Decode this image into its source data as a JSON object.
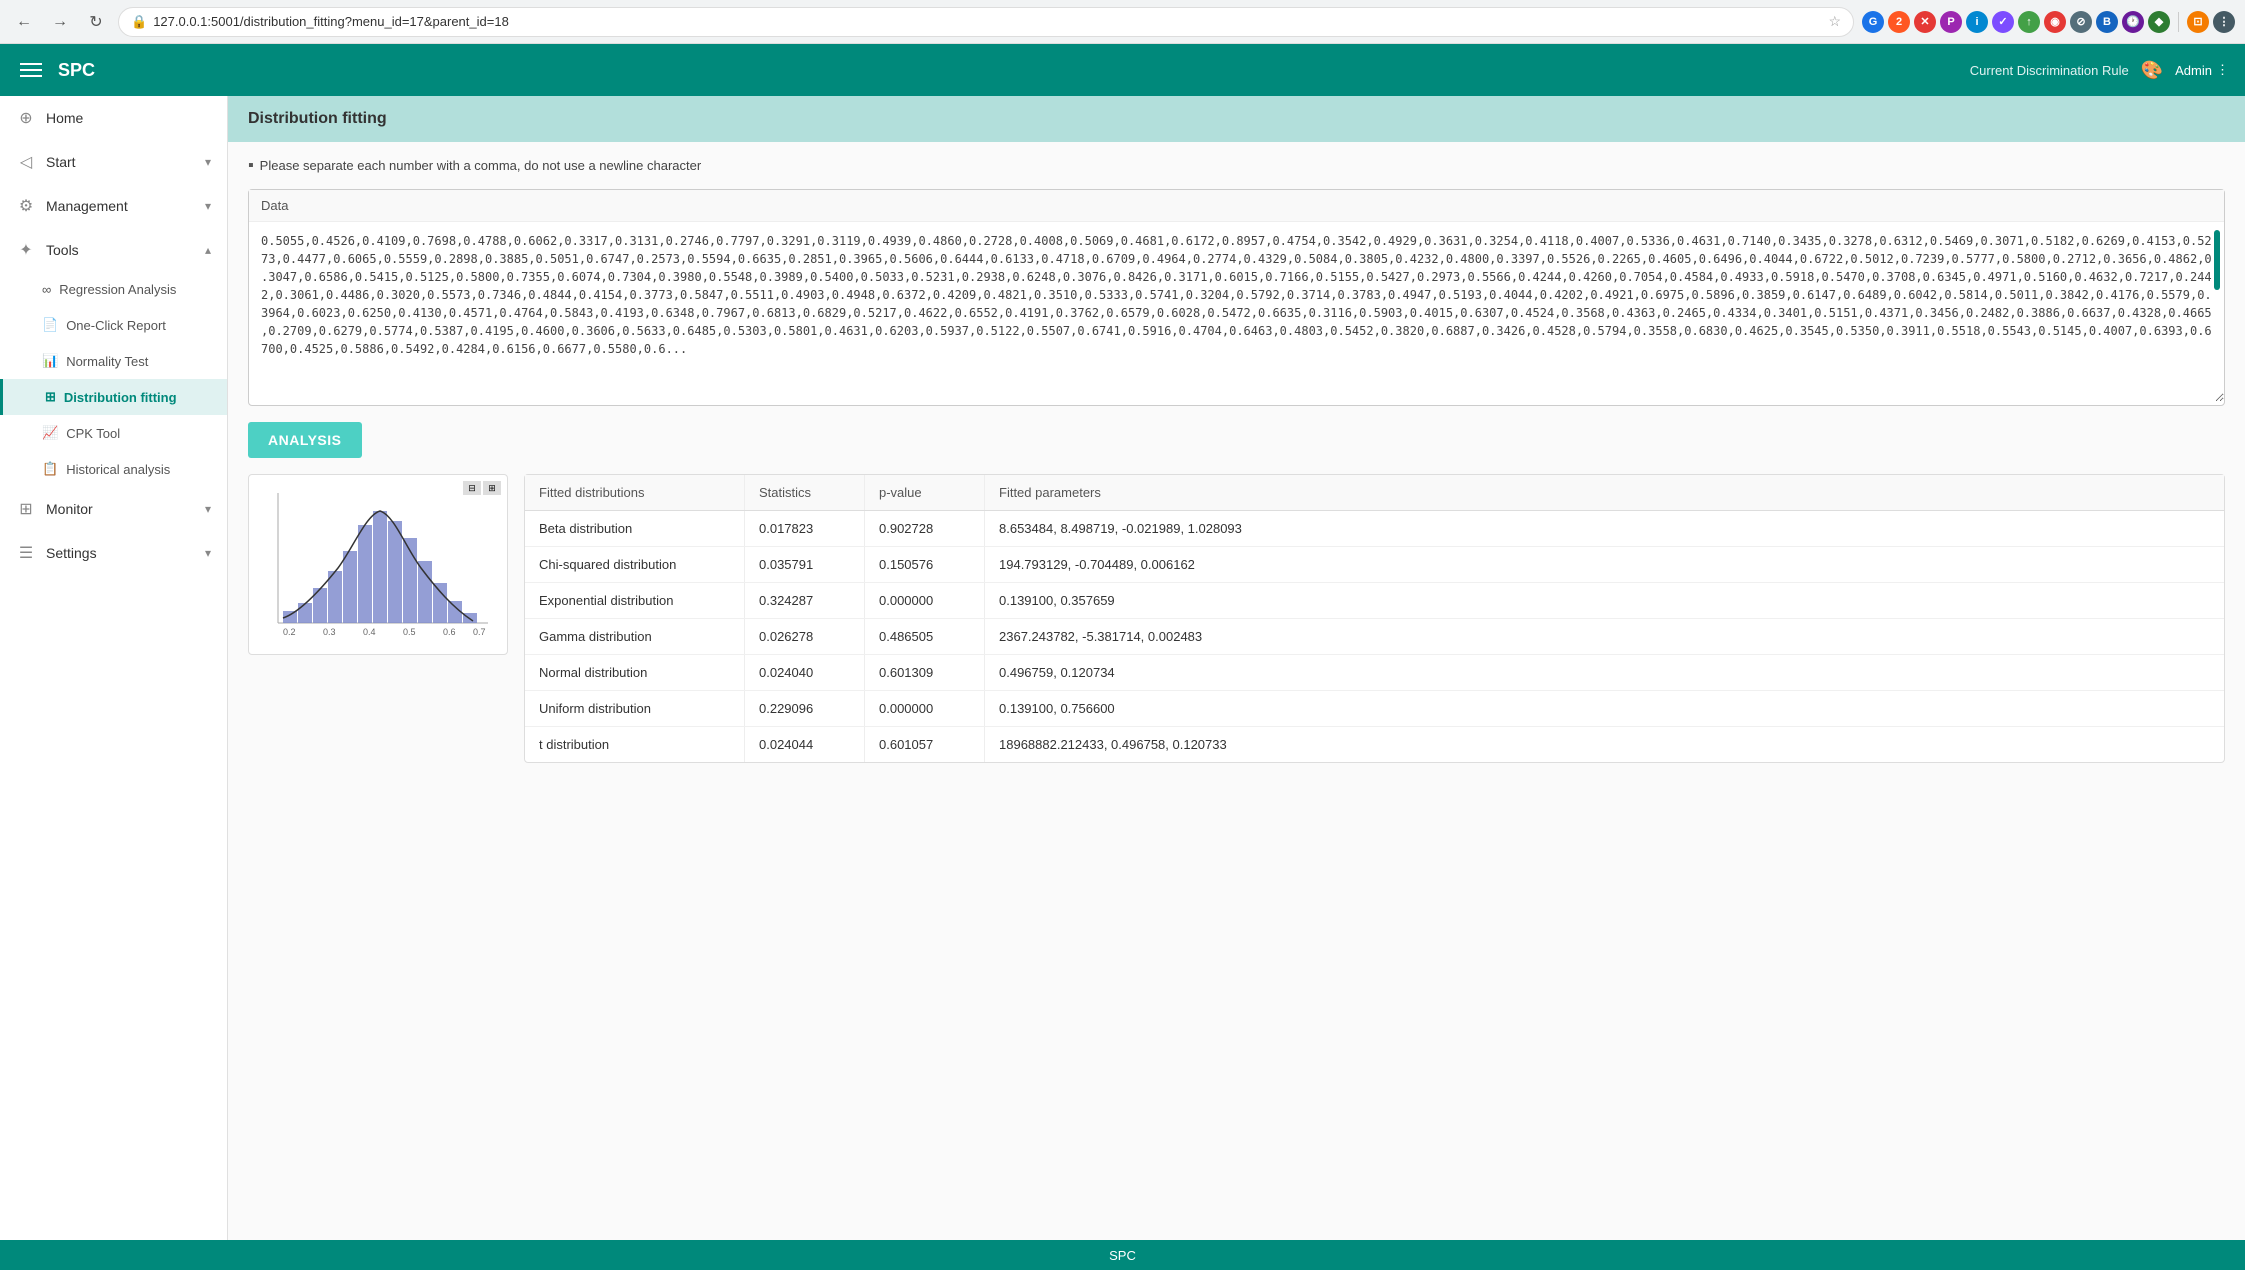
{
  "browser": {
    "url": "127.0.0.1:5001/distribution_fitting?menu_id=17&parent_id=18",
    "nav_back": "←",
    "nav_forward": "→",
    "nav_refresh": "↻"
  },
  "topnav": {
    "hamburger_label": "menu",
    "app_title": "SPC",
    "discrimination_rule_label": "Current Discrimination Rule",
    "palette_icon": "🎨",
    "admin_label": "Admin",
    "admin_icon": "⋮"
  },
  "sidebar": {
    "items": [
      {
        "id": "home",
        "label": "Home",
        "icon": "⊕",
        "has_sub": false
      },
      {
        "id": "start",
        "label": "Start",
        "icon": "◁",
        "has_sub": true,
        "expanded": false
      },
      {
        "id": "management",
        "label": "Management",
        "icon": "⚙",
        "has_sub": true,
        "expanded": false
      },
      {
        "id": "tools",
        "label": "Tools",
        "icon": "✦",
        "has_sub": true,
        "expanded": true
      },
      {
        "id": "monitor",
        "label": "Monitor",
        "icon": "⊞",
        "has_sub": true,
        "expanded": false
      },
      {
        "id": "settings",
        "label": "Settings",
        "icon": "☰",
        "has_sub": true,
        "expanded": false
      }
    ],
    "sub_items": [
      {
        "parent": "tools",
        "id": "regression",
        "label": "Regression Analysis",
        "icon": "∞"
      },
      {
        "parent": "tools",
        "id": "one-click",
        "label": "One-Click Report",
        "icon": "📄"
      },
      {
        "parent": "tools",
        "id": "normality",
        "label": "Normality Test",
        "icon": "📊"
      },
      {
        "parent": "tools",
        "id": "distribution",
        "label": "Distribution fitting",
        "icon": "⊞",
        "active": true
      },
      {
        "parent": "tools",
        "id": "cpk",
        "label": "CPK Tool",
        "icon": "📈"
      },
      {
        "parent": "tools",
        "id": "historical",
        "label": "Historical analysis",
        "icon": "📋"
      }
    ]
  },
  "page": {
    "title": "Distribution fitting",
    "instruction": "Please separate each number with a comma, do not use a newline character",
    "data_label": "Data",
    "data_value": "0.5055,0.4526,0.4109,0.7698,0.4788,0.6062,0.3317,0.3131,0.2746,0.7797,0.3291,0.3119,0.4939,0.4860,0.2728,0.4008,0.5069,0.4681,0.6172,0.8957,0.4754,0.3542,0.4929,0.3631,0.3254,0.4118,0.4007,0.5336,0.4631,0.7140,0.3435,0.3278,0.6312,0.5469,0.3071,0.5182,0.6269,0.4153,0.5273,0.4477,0.6065,0.5559,0.2898,0.3885,0.5051,0.6747,0.2573,0.5594,0.6635,0.2851,0.3965,0.5606,0.6444,0.6133,0.4718,0.6709,0.4964,0.2774,0.4329,0.5084,0.3805,0.4232,0.4800,0.3397,0.5526,0.2265,0.4605,0.6496,0.4044,0.6722,0.5012,0.7239,0.5777,0.5800,0.2712,0.3656,0.4862,0.3047,0.6586,0.5415,0.5125,0.5800,0.7355,0.6074,0.7304,0.3980,0.5548,0.3989,0.5400,0.5033,0.5231,0.2938,0.6248,0.3076,0.8426,0.3171,0.6015,0.7166,0.5155,0.5427,0.2973,0.5566,0.4244,0.4260,0.7054,0.4584,0.4933,0.5918,0.5470,0.3708,0.6345,0.4971,0.5160,0.4632,0.7217,0.2442,0.3061,0.4486,0.3020,0.5573,0.7346,0.4844,0.4154,0.3773,0.5847,0.5511,0.4903,0.4948,0.6372,0.4209,0.4821,0.3510,0.5333,0.5741,0.3204,0.5792,0.3714,0.3783,0.4947,0.5193,0.4044,0.4202,0.4921,0.6975,0.5896,0.3859,0.6147,0.6489,0.6042,0.5814,0.5011,0.3842,0.4176,0.5579,0.3964,0.6023,0.6250,0.4130,0.4571,0.4764,0.5843,0.4193,0.6348,0.7967,0.6813,0.6829,0.5217,0.4622,0.6552,0.4191,0.3762,0.6579,0.6028,0.5472,0.6635,0.3116,0.5903,0.4015,0.6307,0.4524,0.3568,0.4363,0.2465,0.4334,0.3401,0.5151,0.4371,0.3456,0.2482,0.3886,0.6637,0.4328,0.4665,0.2709,0.6279,0.5774,0.5387,0.4195,0.4600,0.3606,0.5633,0.6485,0.5303,0.5801,0.4631,0.6203,0.5937,0.5122,0.5507,0.6741,0.5916,0.4704,0.6463,0.4803,0.5452,0.3820,0.6887,0.3426,0.4528,0.5794,0.3558,0.6830,0.4625,0.3545,0.5350,0.3911,0.5518,0.5543,0.5145,0.4007,0.6393,0.6700,0.4525,0.5886,0.5492,0.4284,0.6156,0.6677,0.5580,0.6...",
    "analysis_btn": "ANALYSIS",
    "table": {
      "headers": [
        "Fitted distributions",
        "Statistics",
        "p-value",
        "Fitted parameters"
      ],
      "rows": [
        {
          "distribution": "Beta distribution",
          "statistics": "0.017823",
          "pvalue": "0.902728",
          "params": "8.653484, 8.498719, -0.021989, 1.028093"
        },
        {
          "distribution": "Chi-squared distribution",
          "statistics": "0.035791",
          "pvalue": "0.150576",
          "params": "194.793129, -0.704489, 0.006162"
        },
        {
          "distribution": "Exponential distribution",
          "statistics": "0.324287",
          "pvalue": "0.000000",
          "params": "0.139100, 0.357659"
        },
        {
          "distribution": "Gamma distribution",
          "statistics": "0.026278",
          "pvalue": "0.486505",
          "params": "2367.243782, -5.381714, 0.002483"
        },
        {
          "distribution": "Normal distribution",
          "statistics": "0.024040",
          "pvalue": "0.601309",
          "params": "0.496759, 0.120734"
        },
        {
          "distribution": "Uniform distribution",
          "statistics": "0.229096",
          "pvalue": "0.000000",
          "params": "0.139100, 0.756600"
        },
        {
          "distribution": "t distribution",
          "statistics": "0.024044",
          "pvalue": "0.601057",
          "params": "18968882.212433, 0.496758, 0.120733"
        }
      ]
    }
  },
  "footer": {
    "label": "SPC"
  }
}
